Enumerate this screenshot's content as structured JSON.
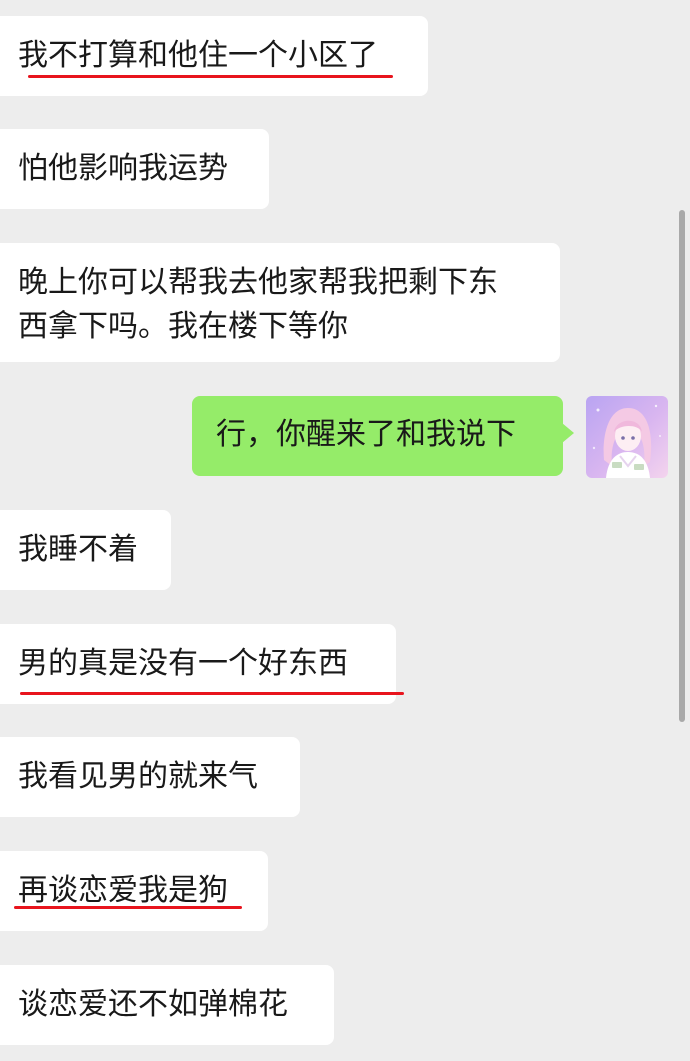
{
  "messages": [
    {
      "side": "in",
      "text": "我不打算和他住一个小区了",
      "underlined": true
    },
    {
      "side": "in",
      "text": "怕他影响我运势",
      "underlined": false
    },
    {
      "side": "in",
      "lines": [
        "晚上你可以帮我去他家帮我把剩下东",
        "西拿下吗。我在楼下等你"
      ],
      "underlined": false
    },
    {
      "side": "out",
      "text": "行，你醒来了和我说下",
      "underlined": false
    },
    {
      "side": "in",
      "text": "我睡不着",
      "underlined": false
    },
    {
      "side": "in",
      "text": "男的真是没有一个好东西",
      "underlined": true
    },
    {
      "side": "in",
      "text": "我看见男的就来气",
      "underlined": false
    },
    {
      "side": "in",
      "text": "再谈恋爱我是狗",
      "underlined": true
    },
    {
      "side": "in",
      "text": "谈恋爱还不如弹棉花",
      "underlined": false
    }
  ],
  "colors": {
    "background": "#ededed",
    "incoming_bubble": "#ffffff",
    "outgoing_bubble": "#95ec69",
    "underline": "#e8141d"
  },
  "icons": {
    "avatar": "anime-girl-avatar-icon"
  }
}
